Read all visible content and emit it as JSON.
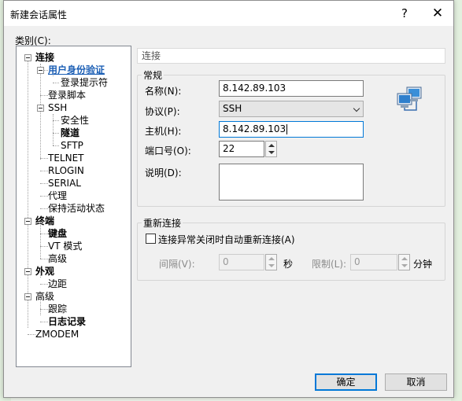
{
  "window": {
    "title": "新建会话属性",
    "help_glyph": "?",
    "close_glyph": "✕"
  },
  "category_label": "类别(C):",
  "category_label_hotkey": "C",
  "tree": {
    "items": [
      {
        "label": "连接"
      },
      {
        "label": "用户身份验证"
      },
      {
        "label": "登录提示符"
      },
      {
        "label": "登录脚本"
      },
      {
        "label": "SSH"
      },
      {
        "label": "安全性"
      },
      {
        "label": "隧道"
      },
      {
        "label": "SFTP"
      },
      {
        "label": "TELNET"
      },
      {
        "label": "RLOGIN"
      },
      {
        "label": "SERIAL"
      },
      {
        "label": "代理"
      },
      {
        "label": "保持活动状态"
      },
      {
        "label": "终端"
      },
      {
        "label": "键盘"
      },
      {
        "label": "VT 模式"
      },
      {
        "label": "高级"
      },
      {
        "label": "外观"
      },
      {
        "label": "边距"
      },
      {
        "label": "高级"
      },
      {
        "label": "跟踪"
      },
      {
        "label": "日志记录"
      },
      {
        "label": "ZMODEM"
      }
    ]
  },
  "main": {
    "section_title": "连接",
    "general_group": "常规",
    "name_label": "名称(N):",
    "name_value": "8.142.89.103",
    "protocol_label": "协议(P):",
    "protocol_value": "SSH",
    "host_label": "主机(H):",
    "host_value": "8.142.89.103",
    "port_label": "端口号(O):",
    "port_value": "22",
    "desc_label": "说明(D):",
    "desc_value": "",
    "reconnect_group": "重新连接",
    "reconnect_checkbox_label": "连接异常关闭时自动重新连接(A)",
    "reconnect_checked": false,
    "interval_label": "间隔(V):",
    "interval_value": "0",
    "interval_unit": "秒",
    "limit_label": "限制(L):",
    "limit_value": "0",
    "limit_unit": "分钟"
  },
  "buttons": {
    "ok": "确定",
    "cancel": "取消"
  },
  "colors": {
    "accent": "#0078d7",
    "selected_tree": "#1c5fb5"
  },
  "icons": {
    "connection": "network-computers-icon"
  }
}
